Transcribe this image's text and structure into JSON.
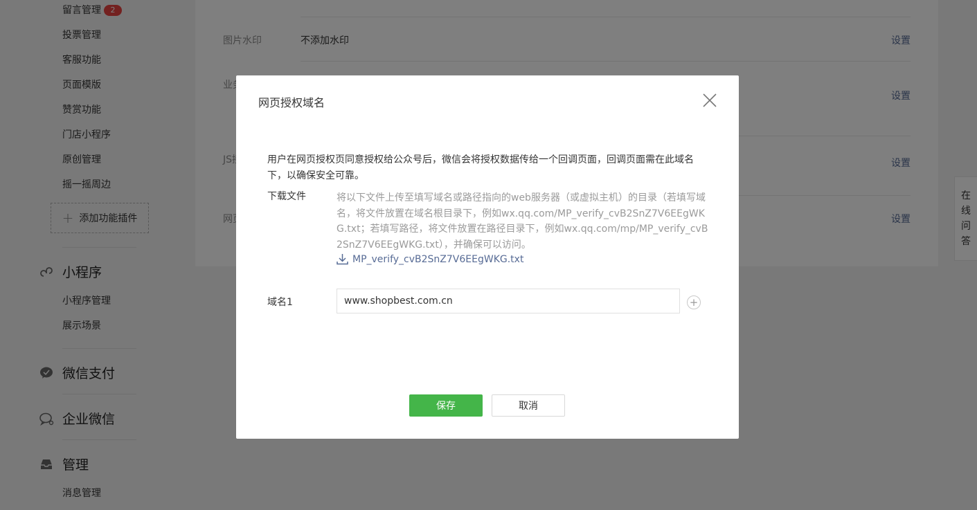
{
  "sidebar": {
    "items_top": [
      {
        "label": "留言管理",
        "badge": "2"
      },
      {
        "label": "投票管理"
      },
      {
        "label": "客服功能"
      },
      {
        "label": "页面模版"
      },
      {
        "label": "赞赏功能"
      },
      {
        "label": "门店小程序"
      },
      {
        "label": "原创管理"
      },
      {
        "label": "摇一摇周边"
      }
    ],
    "add_plugin": "添加功能插件",
    "sections": [
      {
        "title": "小程序",
        "icon": "mini-program-icon",
        "items": [
          "小程序管理",
          "展示场景"
        ]
      },
      {
        "title": "微信支付",
        "icon": "wechat-pay-icon",
        "items": []
      },
      {
        "title": "企业微信",
        "icon": "enterprise-wechat-icon",
        "items": []
      },
      {
        "title": "管理",
        "icon": "inbox-icon",
        "items": [
          "消息管理"
        ]
      }
    ]
  },
  "main": {
    "rows": [
      {
        "label": "图片水印",
        "value": "不添加水印",
        "action": "设置"
      },
      {
        "label": "业务",
        "value": "",
        "action": "设置"
      },
      {
        "label": "JS接",
        "value": "",
        "action": "设置"
      },
      {
        "label": "网页",
        "value": "",
        "action": "设置"
      }
    ]
  },
  "online_qa": [
    "在",
    "线",
    "问",
    "答"
  ],
  "dialog": {
    "title": "网页授权域名",
    "intro": "用户在网页授权页同意授权给公众号后，微信会将授权数据传给一个回调页面，回调页面需在此域名下，以确保安全可靠。",
    "download_label": "下载文件",
    "download_desc": "将以下文件上传至填写域名或路径指向的web服务器（或虚拟主机）的目录（若填写域名，将文件放置在域名根目录下，例如wx.qq.com/MP_verify_cvB2SnZ7V6EEgWKG.txt；若填写路径，将文件放置在路径目录下，例如wx.qq.com/mp/MP_verify_cvB2SnZ7V6EEgWKG.txt），并确保可以访问。",
    "download_file": "MP_verify_cvB2SnZ7V6EEgWKG.txt",
    "domain_label": "域名1",
    "domain_value": "www.shopbest.com.cn",
    "save_label": "保存",
    "cancel_label": "取消"
  },
  "colors": {
    "accent_green": "#44b549",
    "link_blue": "#576b95",
    "badge_red": "#e64340"
  }
}
